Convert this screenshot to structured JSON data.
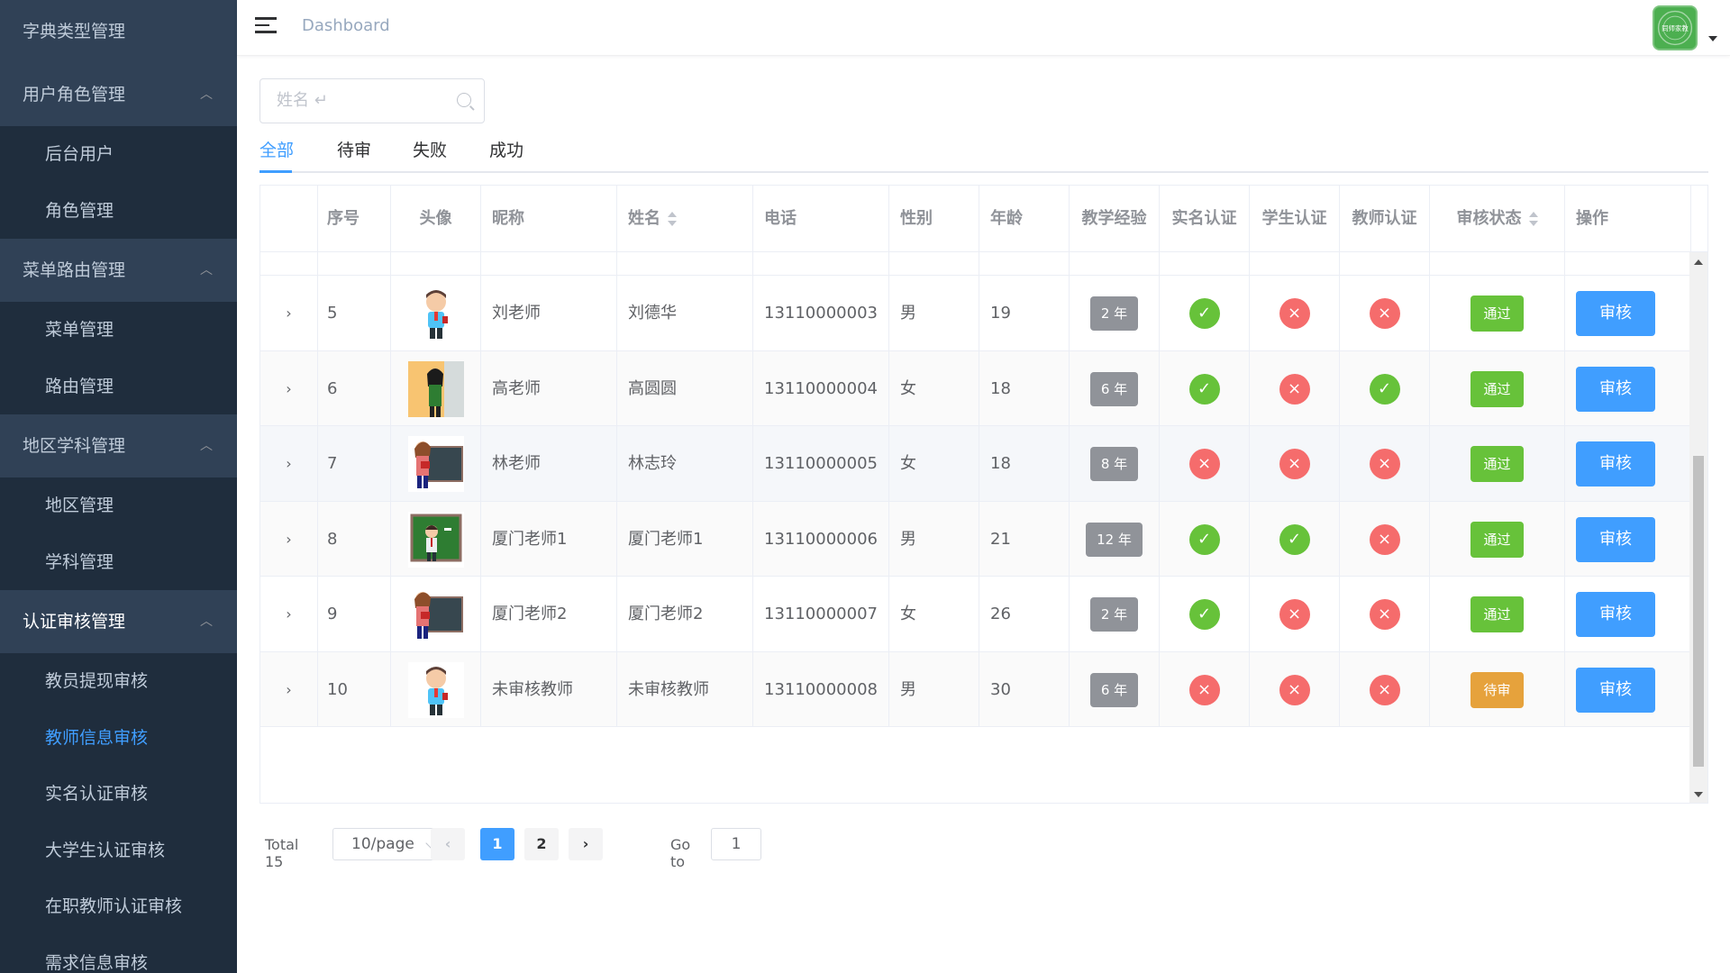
{
  "sidebar": {
    "items": [
      {
        "type": "group",
        "label": "字典类型管理",
        "open": false
      },
      {
        "type": "group",
        "label": "用户角色管理",
        "open": true
      },
      {
        "type": "item",
        "label": "后台用户"
      },
      {
        "type": "item",
        "label": "角色管理"
      },
      {
        "type": "group",
        "label": "菜单路由管理",
        "open": true
      },
      {
        "type": "item",
        "label": "菜单管理"
      },
      {
        "type": "item",
        "label": "路由管理"
      },
      {
        "type": "group",
        "label": "地区学科管理",
        "open": true
      },
      {
        "type": "item",
        "label": "地区管理"
      },
      {
        "type": "item",
        "label": "学科管理"
      },
      {
        "type": "group",
        "label": "认证审核管理",
        "open": true,
        "highlight": true
      },
      {
        "type": "item",
        "label": "教员提现审核"
      },
      {
        "type": "item",
        "label": "教师信息审核",
        "active": true
      },
      {
        "type": "item",
        "label": "实名认证审核"
      },
      {
        "type": "item",
        "label": "大学生认证审核"
      },
      {
        "type": "item",
        "label": "在职教师认证审核"
      },
      {
        "type": "item",
        "label": "需求信息审核"
      }
    ]
  },
  "navbar": {
    "breadcrumb": "Dashboard",
    "avatar_text": "同师家教"
  },
  "search": {
    "placeholder": "姓名 ↵"
  },
  "tabs": [
    "全部",
    "待审",
    "失败",
    "成功"
  ],
  "active_tab": 0,
  "table": {
    "headers": [
      "",
      "序号",
      "头像",
      "昵称",
      "姓名",
      "电话",
      "性别",
      "年龄",
      "教学经验",
      "实名认证",
      "学生认证",
      "教师认证",
      "审核状态",
      "操作"
    ],
    "sortable": [
      "姓名",
      "审核状态"
    ],
    "rows": [
      {
        "no": "5",
        "nickname": "刘老师",
        "name": "刘德华",
        "phone": "13110000003",
        "gender": "男",
        "age": "19",
        "exp": "2 年",
        "real": true,
        "student": false,
        "teacher": false,
        "status": "通过",
        "status_type": "pass",
        "action": "审核",
        "avatar": "boy"
      },
      {
        "no": "6",
        "nickname": "高老师",
        "name": "高圆圆",
        "phone": "13110000004",
        "gender": "女",
        "age": "18",
        "exp": "6 年",
        "real": true,
        "student": false,
        "teacher": true,
        "status": "通过",
        "status_type": "pass",
        "action": "审核",
        "avatar": "girl-board"
      },
      {
        "no": "7",
        "nickname": "林老师",
        "name": "林志玲",
        "phone": "13110000005",
        "gender": "女",
        "age": "18",
        "exp": "8 年",
        "real": false,
        "student": false,
        "teacher": false,
        "status": "通过",
        "status_type": "pass",
        "action": "审核",
        "avatar": "woman-board"
      },
      {
        "no": "8",
        "nickname": "厦门老师1",
        "name": "厦门老师1",
        "phone": "13110000006",
        "gender": "男",
        "age": "21",
        "exp": "12 年",
        "real": true,
        "student": true,
        "teacher": false,
        "status": "通过",
        "status_type": "pass",
        "action": "审核",
        "avatar": "man-board"
      },
      {
        "no": "9",
        "nickname": "厦门老师2",
        "name": "厦门老师2",
        "phone": "13110000007",
        "gender": "女",
        "age": "26",
        "exp": "2 年",
        "real": true,
        "student": false,
        "teacher": false,
        "status": "通过",
        "status_type": "pass",
        "action": "审核",
        "avatar": "woman-board"
      },
      {
        "no": "10",
        "nickname": "未审核教师",
        "name": "未审核教师",
        "phone": "13110000008",
        "gender": "男",
        "age": "30",
        "exp": "6 年",
        "real": false,
        "student": false,
        "teacher": false,
        "status": "待审",
        "status_type": "pend",
        "action": "审核",
        "avatar": "boy"
      }
    ]
  },
  "pagination": {
    "total": "Total 15",
    "page_size": "10/page",
    "pages": [
      "1",
      "2"
    ],
    "current": "1",
    "goto_label": "Go to",
    "goto_value": "1",
    "prev": "‹",
    "next": "›"
  },
  "colors": {
    "sidebar_bg": "#304156",
    "submenu_bg": "#1f2d3d",
    "primary": "#409eff",
    "success": "#67c23a",
    "danger": "#f56c6c",
    "warning": "#e6a23c",
    "info": "#909399"
  }
}
